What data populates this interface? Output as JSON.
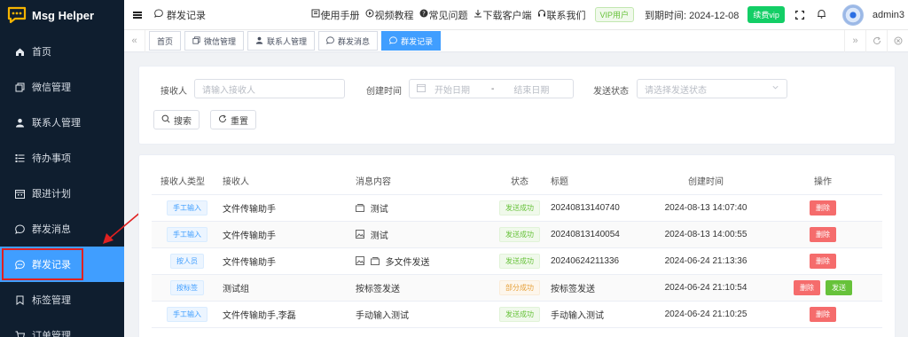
{
  "app": {
    "name": "Msg Helper",
    "brand_color": "#f5b400",
    "accent": "#409eff"
  },
  "sidebar": {
    "items": [
      {
        "label": "首页",
        "icon": "home-icon"
      },
      {
        "label": "微信管理",
        "icon": "copy-icon"
      },
      {
        "label": "联系人管理",
        "icon": "user-icon"
      },
      {
        "label": "待办事项",
        "icon": "list-icon"
      },
      {
        "label": "跟进计划",
        "icon": "calendar-icon"
      },
      {
        "label": "群发消息",
        "icon": "chat-icon"
      },
      {
        "label": "群发记录",
        "icon": "chat-icon",
        "active": true
      },
      {
        "label": "标签管理",
        "icon": "bookmark-icon"
      },
      {
        "label": "订单管理",
        "icon": "cart-icon"
      }
    ]
  },
  "header": {
    "breadcrumb": "群发记录",
    "links": [
      "使用手册",
      "视频教程",
      "常见问题",
      "下载客户端",
      "联系我们"
    ],
    "vip_label": "VIP用户",
    "expire_text": "到期时间: 2024-12-08",
    "renew_label": "续费vip",
    "username": "admin3"
  },
  "tags": [
    {
      "label": "首页"
    },
    {
      "label": "微信管理"
    },
    {
      "label": "联系人管理"
    },
    {
      "label": "群发消息"
    },
    {
      "label": "群发记录",
      "active": true
    }
  ],
  "search": {
    "receiver_label": "接收人",
    "receiver_placeholder": "请输入接收人",
    "created_label": "创建时间",
    "start_placeholder": "开始日期",
    "date_separator": "-",
    "end_placeholder": "结束日期",
    "status_label": "发送状态",
    "status_placeholder": "请选择发送状态",
    "search_button": "搜索",
    "reset_button": "重置"
  },
  "table": {
    "columns": [
      "接收人类型",
      "接收人",
      "消息内容",
      "状态",
      "标题",
      "创建时间",
      "操作"
    ],
    "delete_label": "删除",
    "send_label": "发送",
    "rows": [
      {
        "type": "手工输入",
        "receiver": "文件传输助手",
        "content_icon": "folder-icon",
        "content": "测试",
        "status": "发送成功",
        "status_kind": "ok",
        "title": "20240813140740",
        "created": "2024-08-13 14:07:40",
        "can_send": false
      },
      {
        "type": "手工输入",
        "receiver": "文件传输助手",
        "content_icon": "image-icon",
        "content": "测试",
        "status": "发送成功",
        "status_kind": "ok",
        "title": "20240813140054",
        "created": "2024-08-13 14:00:55",
        "can_send": false
      },
      {
        "type": "按人员",
        "receiver": "文件传输助手",
        "content_icon": "image-folder-icon",
        "content": "多文件发送",
        "status": "发送成功",
        "status_kind": "ok",
        "title": "20240624211336",
        "created": "2024-06-24 21:13:36",
        "can_send": false
      },
      {
        "type": "按标签",
        "receiver": "测试组",
        "content_icon": "",
        "content": "按标签发送",
        "status": "部分成功",
        "status_kind": "part",
        "title": "按标签发送",
        "created": "2024-06-24 21:10:54",
        "can_send": true
      },
      {
        "type": "手工输入",
        "receiver": "文件传输助手,李磊",
        "content_icon": "",
        "content": "手动输入测试",
        "status": "发送成功",
        "status_kind": "ok",
        "title": "手动输入测试",
        "created": "2024-06-24 21:10:25",
        "can_send": false
      }
    ]
  }
}
